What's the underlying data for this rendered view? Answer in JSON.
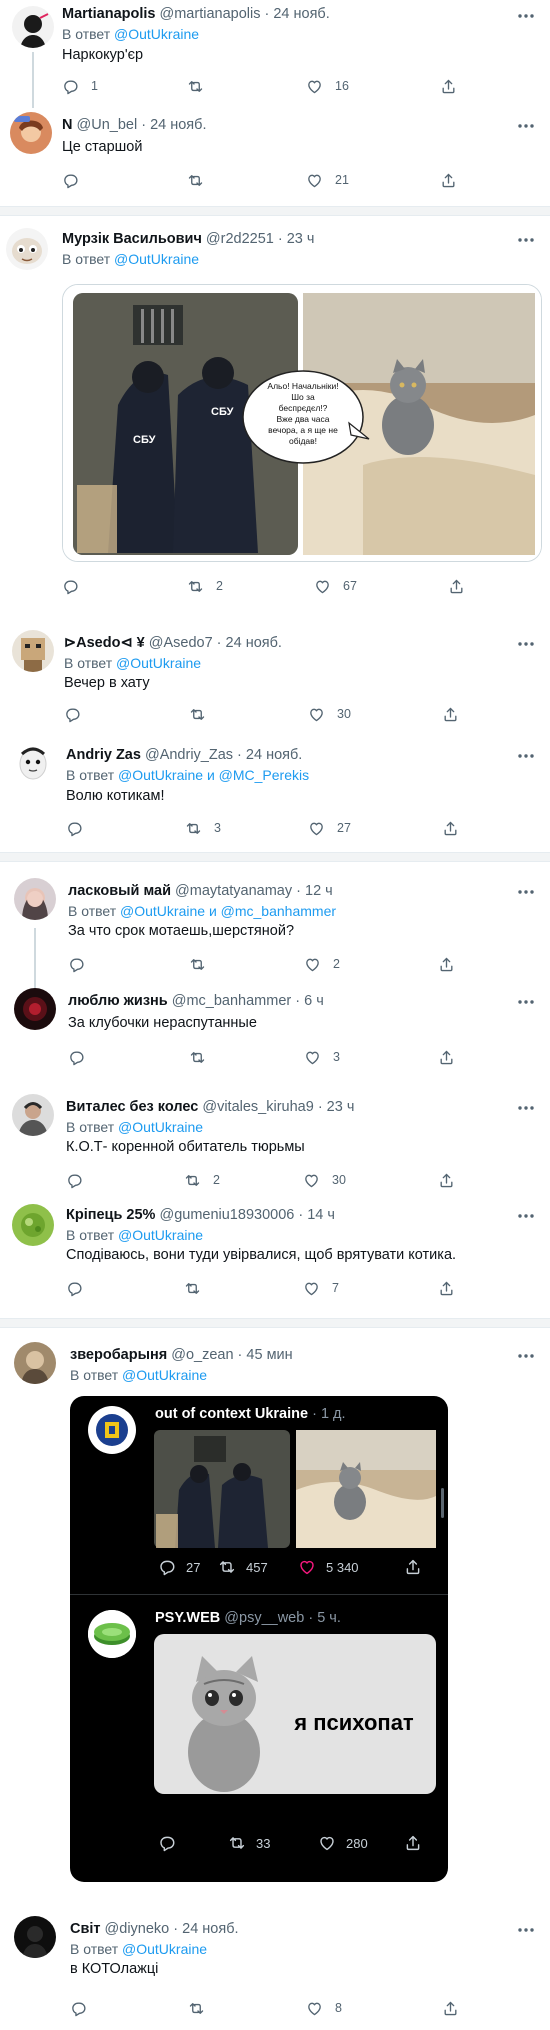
{
  "tweets": [
    {
      "name": "Martianapolis",
      "handle": "@martianapolis · 24 нояб.",
      "reply_prefix": "В ответ",
      "reply_to": "@OutUkraine",
      "text": "Наркокур'єр",
      "replies": "1",
      "retweets": "",
      "likes": "16"
    },
    {
      "name": "N",
      "handle": "@Un_bel · 24 нояб.",
      "reply_prefix": "В ответ",
      "reply_to": "",
      "text": "Це старшой",
      "replies": "",
      "retweets": "",
      "likes": "21"
    },
    {
      "name": "Мурзік Васильович",
      "handle": "@r2d2251 · 23 ч",
      "reply_prefix": "В ответ",
      "reply_to": "@OutUkraine",
      "text": "",
      "replies": "",
      "retweets": "2",
      "likes": "67"
    },
    {
      "name": "⊳Asedo⊲ ¥",
      "handle": "@Asedo7 · 24 нояб.",
      "reply_prefix": "В ответ",
      "reply_to": "@OutUkraine",
      "text": "Вечер в хату",
      "replies": "",
      "retweets": "",
      "likes": "30"
    },
    {
      "name": "Andriy Zas",
      "handle": "@Andriy_Zas · 24 нояб.",
      "reply_prefix": "В ответ",
      "reply_to": "@OutUkraine и @MC_Perekis",
      "text": "Волю котикам!",
      "replies": "",
      "retweets": "3",
      "likes": "27"
    },
    {
      "name": "ласковый май",
      "handle": "@maytatyanamay · 12 ч",
      "reply_prefix": "В ответ",
      "reply_to": "@OutUkraine и @mc_banhammer",
      "text": "За что срок мотаешь,шерстяной?",
      "replies": "",
      "retweets": "",
      "likes": "2"
    },
    {
      "name": "люблю жизнь",
      "handle": "@mc_banhammer · 6 ч",
      "reply_prefix": "",
      "reply_to": "",
      "text": "За клубочки нераспутанные",
      "replies": "",
      "retweets": "",
      "likes": "3"
    },
    {
      "name": "Виталес без колес",
      "handle": "@vitales_kiruha9 · 23 ч",
      "reply_prefix": "В ответ",
      "reply_to": "@OutUkraine",
      "text": "К.О.Т- коренной обитатель тюрьмы",
      "replies": "",
      "retweets": "2",
      "likes": "30"
    },
    {
      "name": "Кріпець 25%",
      "handle": "@gumeniu18930006 · 14 ч",
      "reply_prefix": "В ответ",
      "reply_to": "@OutUkraine",
      "text": "Сподіваюсь, вони туди увірвалися, щоб врятувати котика.",
      "replies": "",
      "retweets": "",
      "likes": "7"
    },
    {
      "name": "зверобарыня",
      "handle": "@o_zean · 45 мин",
      "reply_prefix": "В ответ",
      "reply_to": "@OutUkraine",
      "text": "",
      "replies": "",
      "retweets": "",
      "likes": ""
    },
    {
      "name": "Світ",
      "handle": "@diyneko · 24 нояб.",
      "reply_prefix": "В ответ",
      "reply_to": "@OutUkraine",
      "text": "в КОТОлажці",
      "replies": "",
      "retweets": "",
      "likes": "8"
    }
  ],
  "meme": {
    "sbu_label": "СБУ",
    "speech": [
      "Альо! Начальніки!",
      "Шо за",
      "беспрєдєл!?",
      "Вже два часа",
      "вечора, а я ще не",
      "обідав!"
    ]
  },
  "embedded": {
    "post1": {
      "name": "out of context Ukraine",
      "meta": "· 1 д.",
      "replies": "27",
      "retweets": "457",
      "likes": "5 340"
    },
    "post2": {
      "name": "PSY.WEB",
      "meta": "@psy__web · 5 ч.",
      "caption": "я психопат",
      "replies": "",
      "retweets": "33",
      "likes": "280"
    }
  },
  "colors": {
    "link": "#1d9bf0",
    "muted": "#536471",
    "like_pink": "#f91880"
  },
  "icons": [
    "reply-icon",
    "retweet-icon",
    "like-icon",
    "share-icon",
    "more-icon"
  ]
}
